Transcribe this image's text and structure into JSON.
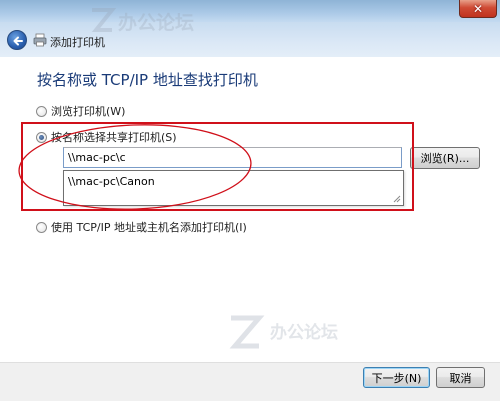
{
  "window": {
    "close_icon": "close-icon",
    "close_glyph": "✕"
  },
  "nav": {
    "title": "添加打印机",
    "back_icon": "back-arrow-icon",
    "printer_icon": "printer-icon"
  },
  "main": {
    "heading": "按名称或 TCP/IP 地址查找打印机",
    "options": [
      {
        "label": "浏览打印机(W)",
        "checked": false
      },
      {
        "label": "按名称选择共享打印机(S)",
        "checked": true
      },
      {
        "label": "使用 TCP/IP 地址或主机名添加打印机(I)",
        "checked": false
      }
    ],
    "share_input": {
      "value": "\\\\mac-pc\\c"
    },
    "suggestions": [
      "\\\\mac-pc\\Canon"
    ],
    "browse_button": "浏览(R)..."
  },
  "footer": {
    "next_button": "下一步(N)",
    "cancel_button": "取消"
  },
  "watermark": {
    "text": "办公论坛"
  },
  "colors": {
    "annotation_red": "#d0101a",
    "heading_blue": "#1a3b78",
    "titlebar_blue": "#a9c8e6"
  }
}
